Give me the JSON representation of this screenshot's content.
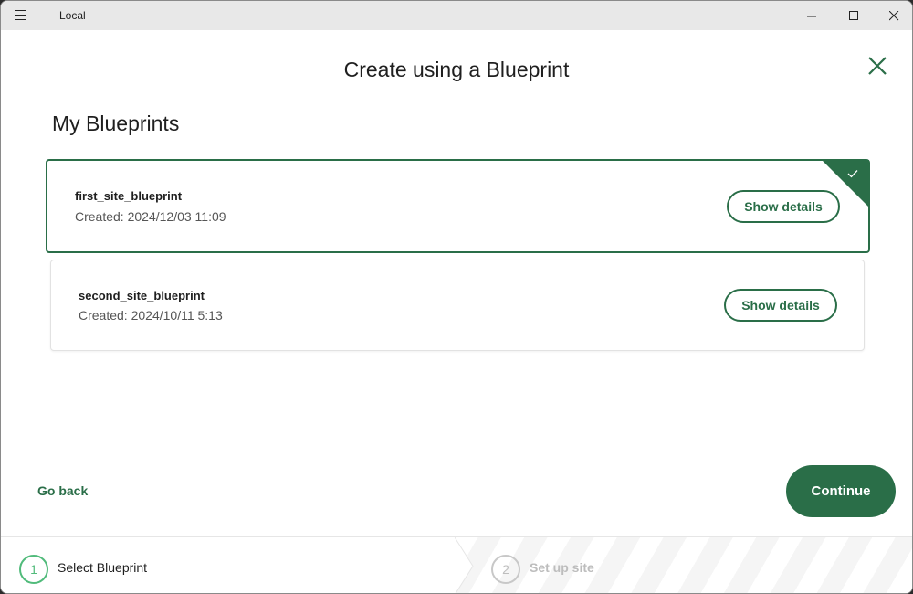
{
  "window": {
    "app_title": "Local",
    "controls": {
      "minimize": "minimize",
      "maximize": "maximize",
      "close": "close"
    }
  },
  "modal": {
    "title": "Create using a Blueprint",
    "close_icon": "close-icon"
  },
  "section": {
    "title": "My Blueprints"
  },
  "blueprints": [
    {
      "name": "first_site_blueprint",
      "created": "Created: 2024/12/03 11:09",
      "selected": true,
      "action_label": "Show details"
    },
    {
      "name": "second_site_blueprint",
      "created": "Created: 2024/10/11 5:13",
      "selected": false,
      "action_label": "Show details"
    }
  ],
  "footer": {
    "back_label": "Go back",
    "continue_label": "Continue"
  },
  "stepper": {
    "steps": [
      {
        "number": "1",
        "label": "Select Blueprint",
        "state": "active"
      },
      {
        "number": "2",
        "label": "Set up site",
        "state": "inactive"
      }
    ]
  },
  "colors": {
    "accent": "#2a6e48",
    "step_active": "#51bb7b",
    "step_inactive": "#bdbdbd"
  }
}
